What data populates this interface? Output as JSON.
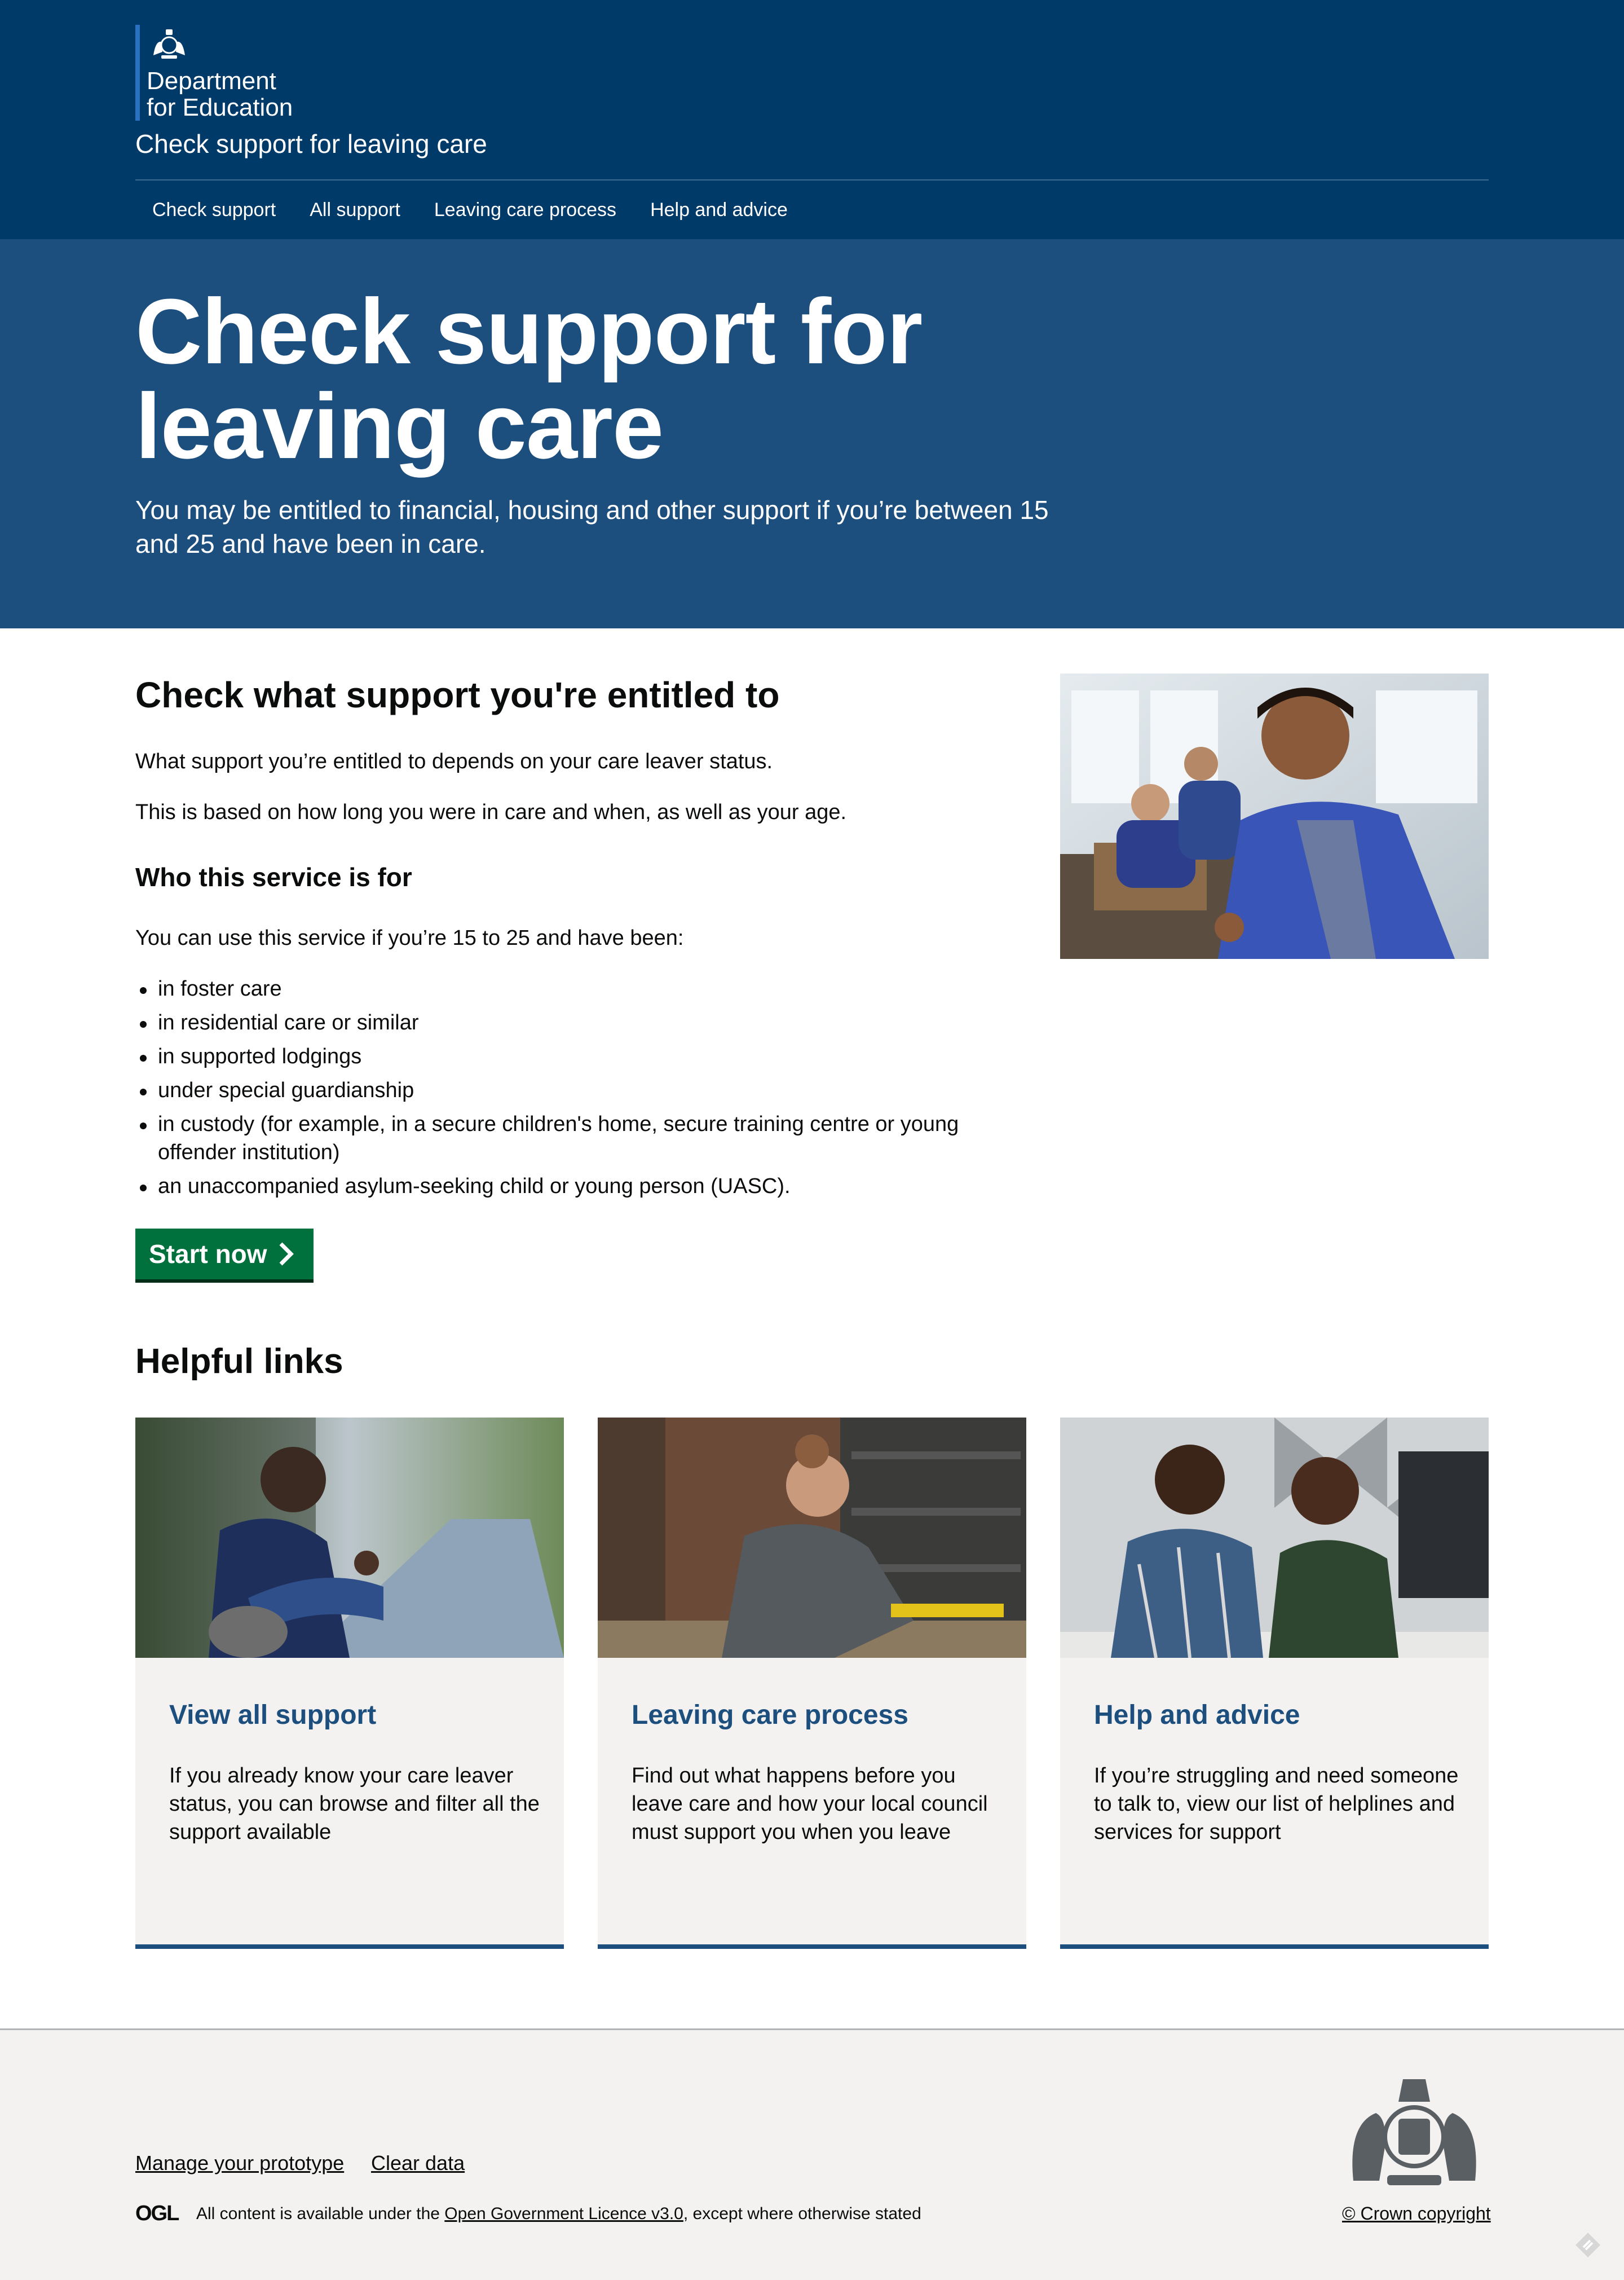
{
  "header": {
    "department_line1": "Department",
    "department_line2": "for Education",
    "service_name": "Check support for leaving care",
    "nav": [
      "Check support",
      "All support",
      "Leaving care process",
      "Help and advice"
    ]
  },
  "hero": {
    "title": "Check support for leaving care",
    "lede": "You may be entitled to financial, housing and other support if you’re between 15 and 25 and have been in care."
  },
  "main": {
    "heading": "Check what support you're entitled to",
    "para1": "What support you’re entitled to depends on your care leaver status.",
    "para2": "This is based on how long you were in care and when, as well as your age.",
    "subheading": "Who this service is for",
    "para3": "You can use this service if you’re 15 to 25 and have been:",
    "eligibility": [
      "in foster care",
      "in residential care or similar",
      "in supported lodgings",
      "under special guardianship",
      "in custody (for example, in a secure children's home, secure training centre or young offender institution)",
      "an unaccompanied asylum-seeking child or young person (UASC)."
    ],
    "start_button": "Start now"
  },
  "helpful_links": {
    "heading": "Helpful links",
    "cards": [
      {
        "title": "View all support",
        "description": "If you already know your care leaver status, you can browse and filter all the support available"
      },
      {
        "title": "Leaving care process",
        "description": "Find out what happens before you leave care and how your local council must support you when you leave"
      },
      {
        "title": "Help and advice",
        "description": "If you’re struggling and need someone to talk to, view our list of helplines and services for support"
      }
    ]
  },
  "footer": {
    "manage_prototype": "Manage your prototype",
    "clear_data": "Clear data",
    "ogl_logo": "OGL",
    "licence_prefix": "All content is available under the",
    "licence_link": "Open Government Licence v3.0",
    "licence_suffix": ", except where otherwise stated",
    "copyright": "© Crown copyright"
  },
  "colors": {
    "header_bg": "#003a69",
    "hero_bg": "#1d4f7e",
    "start_button": "#00703c",
    "link": "#1d4f7e",
    "footer_bg": "#f3f2f1"
  },
  "icons": {
    "dept_logo": "royal-crest-icon",
    "start_chevron": "chevron-right-icon",
    "footer_crest": "royal-coat-of-arms-icon"
  }
}
